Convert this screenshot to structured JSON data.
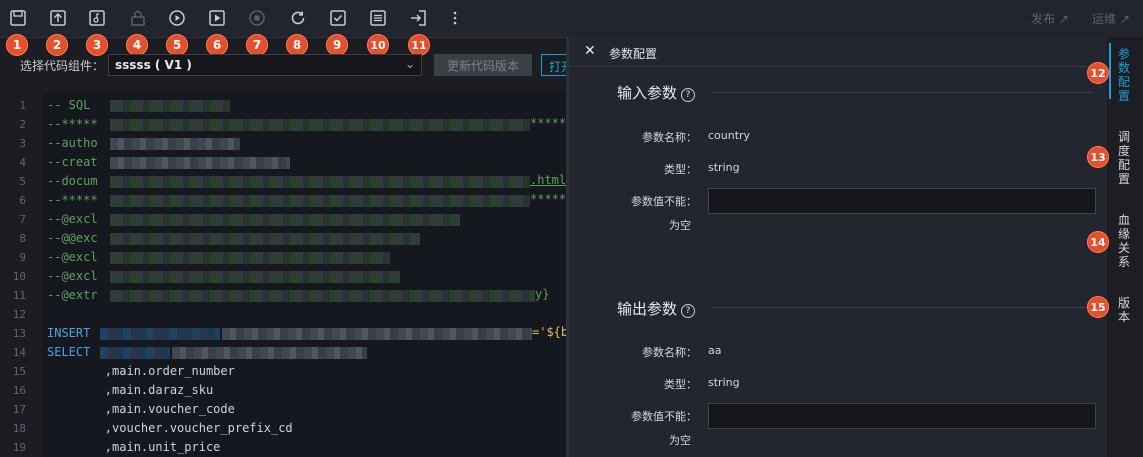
{
  "toolbar": {
    "buttons": [
      "save-icon",
      "submit-icon",
      "steal-lock-icon",
      "lock-icon",
      "run-icon",
      "run-with-params-icon",
      "stop-icon",
      "reload-icon",
      "check-icon",
      "format-icon",
      "exit-icon",
      "more-icon"
    ],
    "publish_label": "发布",
    "ops_label": "运维"
  },
  "markers": [
    "1",
    "2",
    "3",
    "4",
    "5",
    "6",
    "7",
    "8",
    "9",
    "10",
    "11",
    "12",
    "13",
    "14",
    "15"
  ],
  "selector": {
    "label": "选择代码组件：",
    "value": "sssss ( V1 )",
    "update_button": "更新代码版本",
    "open_button": "打开"
  },
  "editor": {
    "line_numbers": [
      "1",
      "2",
      "3",
      "4",
      "5",
      "6",
      "7",
      "8",
      "9",
      "10",
      "11",
      "12",
      "13",
      "14",
      "15",
      "16",
      "17",
      "18",
      "19"
    ],
    "lines": [
      {
        "text": "-- SQL",
        "cls": "c-com"
      },
      {
        "text": "--*****",
        "cls": "c-com"
      },
      {
        "text": "--autho",
        "cls": "c-com"
      },
      {
        "text": "--creat",
        "cls": "c-com"
      },
      {
        "text": "--docum",
        "cls": "c-com"
      },
      {
        "text": "--*****",
        "cls": "c-com"
      },
      {
        "text": "--@excl",
        "cls": "c-com"
      },
      {
        "text": "--@@exc",
        "cls": "c-com"
      },
      {
        "text": "--@excl",
        "cls": "c-com"
      },
      {
        "text": "--@excl",
        "cls": "c-com"
      },
      {
        "text": "--@extr",
        "cls": "c-com"
      },
      {
        "text": "",
        "cls": "c-txt"
      },
      {
        "text": "INSERT",
        "cls": "c-kw"
      },
      {
        "text": "SELECT",
        "cls": "c-kw"
      },
      {
        "text": "        ,main.order_number",
        "cls": "c-txt"
      },
      {
        "text": "        ,main.daraz_sku",
        "cls": "c-txt"
      },
      {
        "text": "        ,main.voucher_code",
        "cls": "c-txt"
      },
      {
        "text": "        ,voucher.voucher_prefix_cd",
        "cls": "c-txt"
      },
      {
        "text": "        ,main.unit_price",
        "cls": "c-txt"
      }
    ],
    "tail_2": "*****",
    "tail_5": ".html",
    "tail_6": "*****",
    "tail_11": "y}",
    "tail_13": "='${b"
  },
  "panel": {
    "title": "参数配置",
    "input_section": "输入参数",
    "output_section": "输出参数",
    "input_param": {
      "name_label": "参数名称：",
      "name": "country",
      "type_label": "类型：",
      "type": "string",
      "required_label_1": "参数值不能：",
      "required_label_2": "为空"
    },
    "output_param": {
      "name_label": "参数名称：",
      "name": "aa",
      "type_label": "类型：",
      "type": "string",
      "required_label_1": "参数值不能：",
      "required_label_2": "为空"
    }
  },
  "sidebar": {
    "tabs": [
      "参数配置",
      "调度配置",
      "血缘关系",
      "版本"
    ]
  },
  "colors": {
    "accent": "#1aa0d8",
    "marker": "#e3502b"
  }
}
